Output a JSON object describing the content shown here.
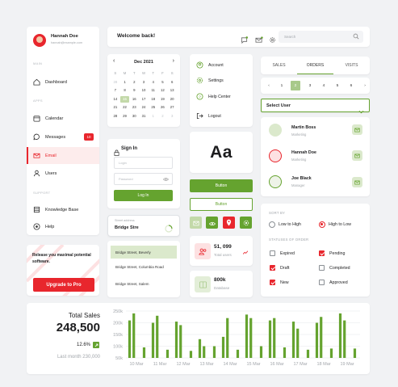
{
  "sidebar": {
    "user_name": "Hannah Doe",
    "user_email": "hannah@example.com",
    "sections": {
      "main": "MAIN",
      "apps": "APPS",
      "support": "SUPPORT"
    },
    "items": [
      {
        "label": "Dashboard",
        "icon": "home-icon"
      },
      {
        "label": "Calendar",
        "icon": "calendar-icon"
      },
      {
        "label": "Messages",
        "icon": "chat-icon",
        "badge": "10"
      },
      {
        "label": "Email",
        "icon": "mail-icon",
        "active": true
      },
      {
        "label": "Users",
        "icon": "user-icon"
      },
      {
        "label": "Knowledge Base",
        "icon": "book-icon"
      },
      {
        "label": "Help",
        "icon": "help-icon"
      }
    ]
  },
  "upgrade": {
    "text": "Release you maximal potential software.",
    "button": "Upgrade to Pro"
  },
  "header": {
    "welcome": "Welcome back!",
    "search_placeholder": "Search"
  },
  "calendar": {
    "month": "Dec 2021",
    "weekdays": [
      "S",
      "M",
      "T",
      "W",
      "T",
      "F",
      "S"
    ],
    "days": [
      "28",
      "1",
      "2",
      "3",
      "4",
      "5",
      "6",
      "7",
      "8",
      "9",
      "10",
      "11",
      "12",
      "13",
      "14",
      "15",
      "16",
      "17",
      "18",
      "19",
      "20",
      "21",
      "22",
      "23",
      "24",
      "25",
      "26",
      "27",
      "28",
      "29",
      "30",
      "31",
      "1",
      "2",
      "3"
    ],
    "selected": "15"
  },
  "signin": {
    "title": "Sign In",
    "login_placeholder": "Login",
    "password_placeholder": "Password",
    "button": "Log In"
  },
  "address": {
    "label": "Street address",
    "value": "Bridge Stre"
  },
  "dropdown": {
    "items": [
      "Bridge Street, Beverly",
      "Bridge Street, Columbia Road",
      "Bridge Street, Salem"
    ]
  },
  "profile_menu": {
    "items": [
      "Account",
      "Settings",
      "Help Center",
      "Logout"
    ]
  },
  "typography": {
    "sample": "Aa"
  },
  "buttons": {
    "solid": "Button",
    "outline": "Button"
  },
  "stats": {
    "users_value": "51, 099",
    "users_label": "Total users",
    "db_value": "800k",
    "db_label": "Database"
  },
  "tabs": {
    "items": [
      "SALES",
      "ORDERS",
      "VISITS"
    ],
    "active": "ORDERS"
  },
  "pagination": {
    "prev": "‹",
    "next": "›",
    "pages": [
      "1",
      "2",
      "3",
      "4",
      "5",
      "6"
    ],
    "active": "2"
  },
  "select_user": {
    "label": "Select User"
  },
  "users": [
    {
      "name": "Martin Boss",
      "role": "Marketing"
    },
    {
      "name": "Hannah Doe",
      "role": "Marketing"
    },
    {
      "name": "Joe Black",
      "role": "Manager"
    }
  ],
  "filters": {
    "sort_label": "SORT BY",
    "sort_options": [
      "Low to High",
      "High to Low"
    ],
    "sort_selected": "High to Low",
    "status_label": "STATUSES OF ORDER",
    "statuses": [
      {
        "label": "Expired",
        "checked": false
      },
      {
        "label": "Pending",
        "checked": true
      },
      {
        "label": "Draft",
        "checked": true
      },
      {
        "label": "Completed",
        "checked": false
      },
      {
        "label": "New",
        "checked": true
      },
      {
        "label": "Approved",
        "checked": false
      }
    ]
  },
  "sales": {
    "title": "Total Sales",
    "value": "248,500",
    "change": "12.6%",
    "last_month": "Last month 230,000"
  },
  "chart_data": {
    "type": "bar",
    "categories": [
      "10 Mar",
      "11 Mar",
      "12 Mar",
      "13 Mar",
      "14 Mar",
      "15 Mar",
      "16 Mar",
      "17 Mar",
      "18 Mar",
      "19 Mar"
    ],
    "series": [
      {
        "values": [
          210,
          200,
          205,
          130,
          140,
          235,
          210,
          205,
          200,
          240
        ]
      },
      {
        "values": [
          240,
          230,
          190,
          100,
          220,
          220,
          220,
          175,
          225,
          210
        ]
      },
      {
        "values": [
          95,
          85,
          80,
          100,
          85,
          100,
          95,
          85,
          90,
          90
        ]
      }
    ],
    "ylim": [
      50,
      250
    ],
    "yticks": [
      "250k",
      "200k",
      "150k",
      "100k",
      "50k"
    ],
    "grid": true
  },
  "colors": {
    "accent": "#65a32f",
    "danger": "#e8262d",
    "background": "#f1f2f4"
  }
}
